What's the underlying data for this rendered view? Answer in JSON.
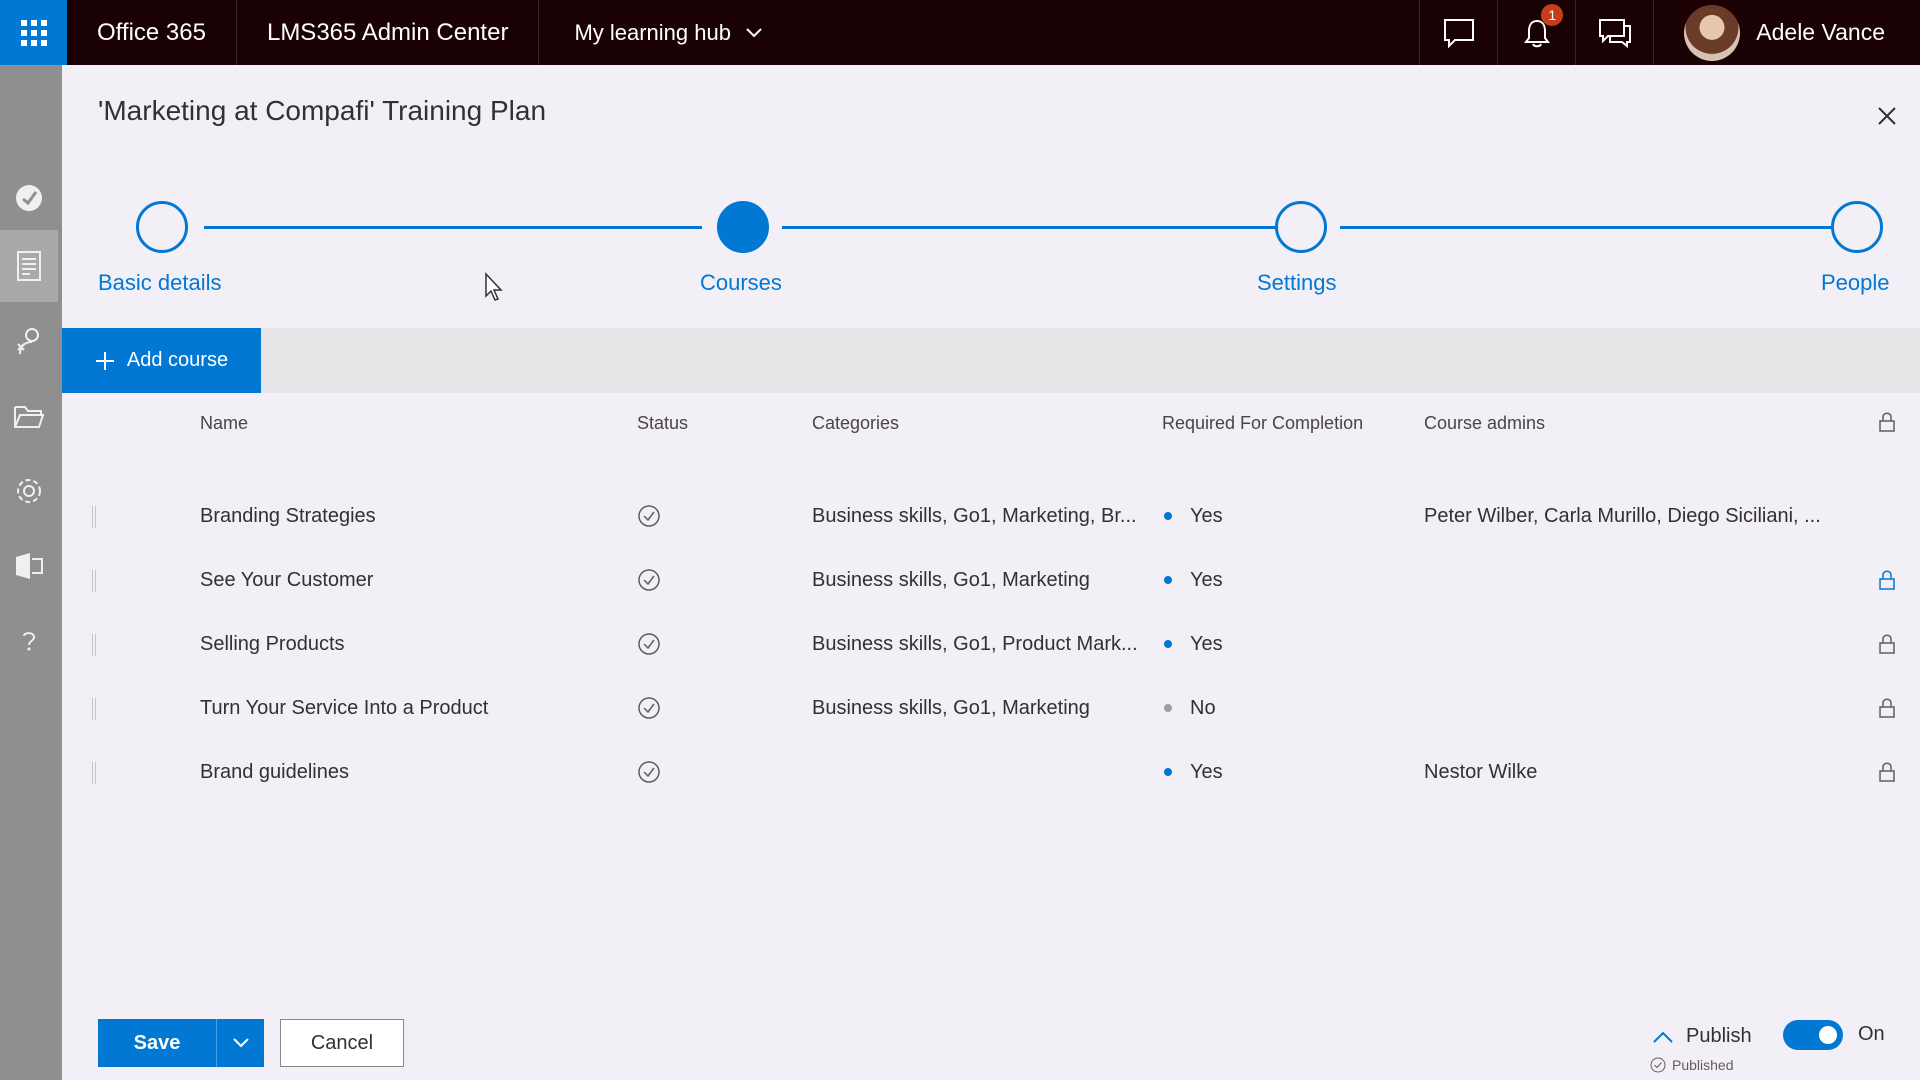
{
  "topbar": {
    "app_name": "Office 365",
    "center_name": "LMS365 Admin Center",
    "hub_label": "My learning hub",
    "notification_count": "1",
    "user_name": "Adele Vance"
  },
  "panel": {
    "title": "'Marketing at Compafi' Training Plan"
  },
  "stepper": {
    "steps": [
      {
        "label": "Basic details",
        "active": false
      },
      {
        "label": "Courses",
        "active": true
      },
      {
        "label": "Settings",
        "active": false
      },
      {
        "label": "People",
        "active": false
      }
    ]
  },
  "toolbar": {
    "add_course_label": "Add course"
  },
  "table": {
    "headers": {
      "name": "Name",
      "status": "Status",
      "categories": "Categories",
      "required": "Required For Completion",
      "admins": "Course admins"
    },
    "rows": [
      {
        "name": "Branding Strategies",
        "categories": "Business skills, Go1, Marketing, Br...",
        "required": "Yes",
        "admins": "Peter Wilber, Carla Murillo, Diego Siciliani, ...",
        "lock": "none"
      },
      {
        "name": "See Your Customer",
        "categories": "Business skills, Go1, Marketing",
        "required": "Yes",
        "admins": "",
        "lock": "blue"
      },
      {
        "name": "Selling Products",
        "categories": "Business skills, Go1, Product Mark...",
        "required": "Yes",
        "admins": "",
        "lock": "gray"
      },
      {
        "name": "Turn Your Service Into a Product",
        "categories": "Business skills, Go1, Marketing",
        "required": "No",
        "admins": "",
        "lock": "gray"
      },
      {
        "name": "Brand guidelines",
        "categories": "",
        "required": "Yes",
        "admins": "Nestor Wilke",
        "lock": "gray"
      }
    ]
  },
  "footer": {
    "save_label": "Save",
    "cancel_label": "Cancel",
    "publish_label": "Publish",
    "published_status": "Published",
    "toggle_label": "On"
  },
  "colors": {
    "accent": "#0078d4",
    "topbar_bg": "#1a0204",
    "panel_bg": "#f3eff6"
  }
}
